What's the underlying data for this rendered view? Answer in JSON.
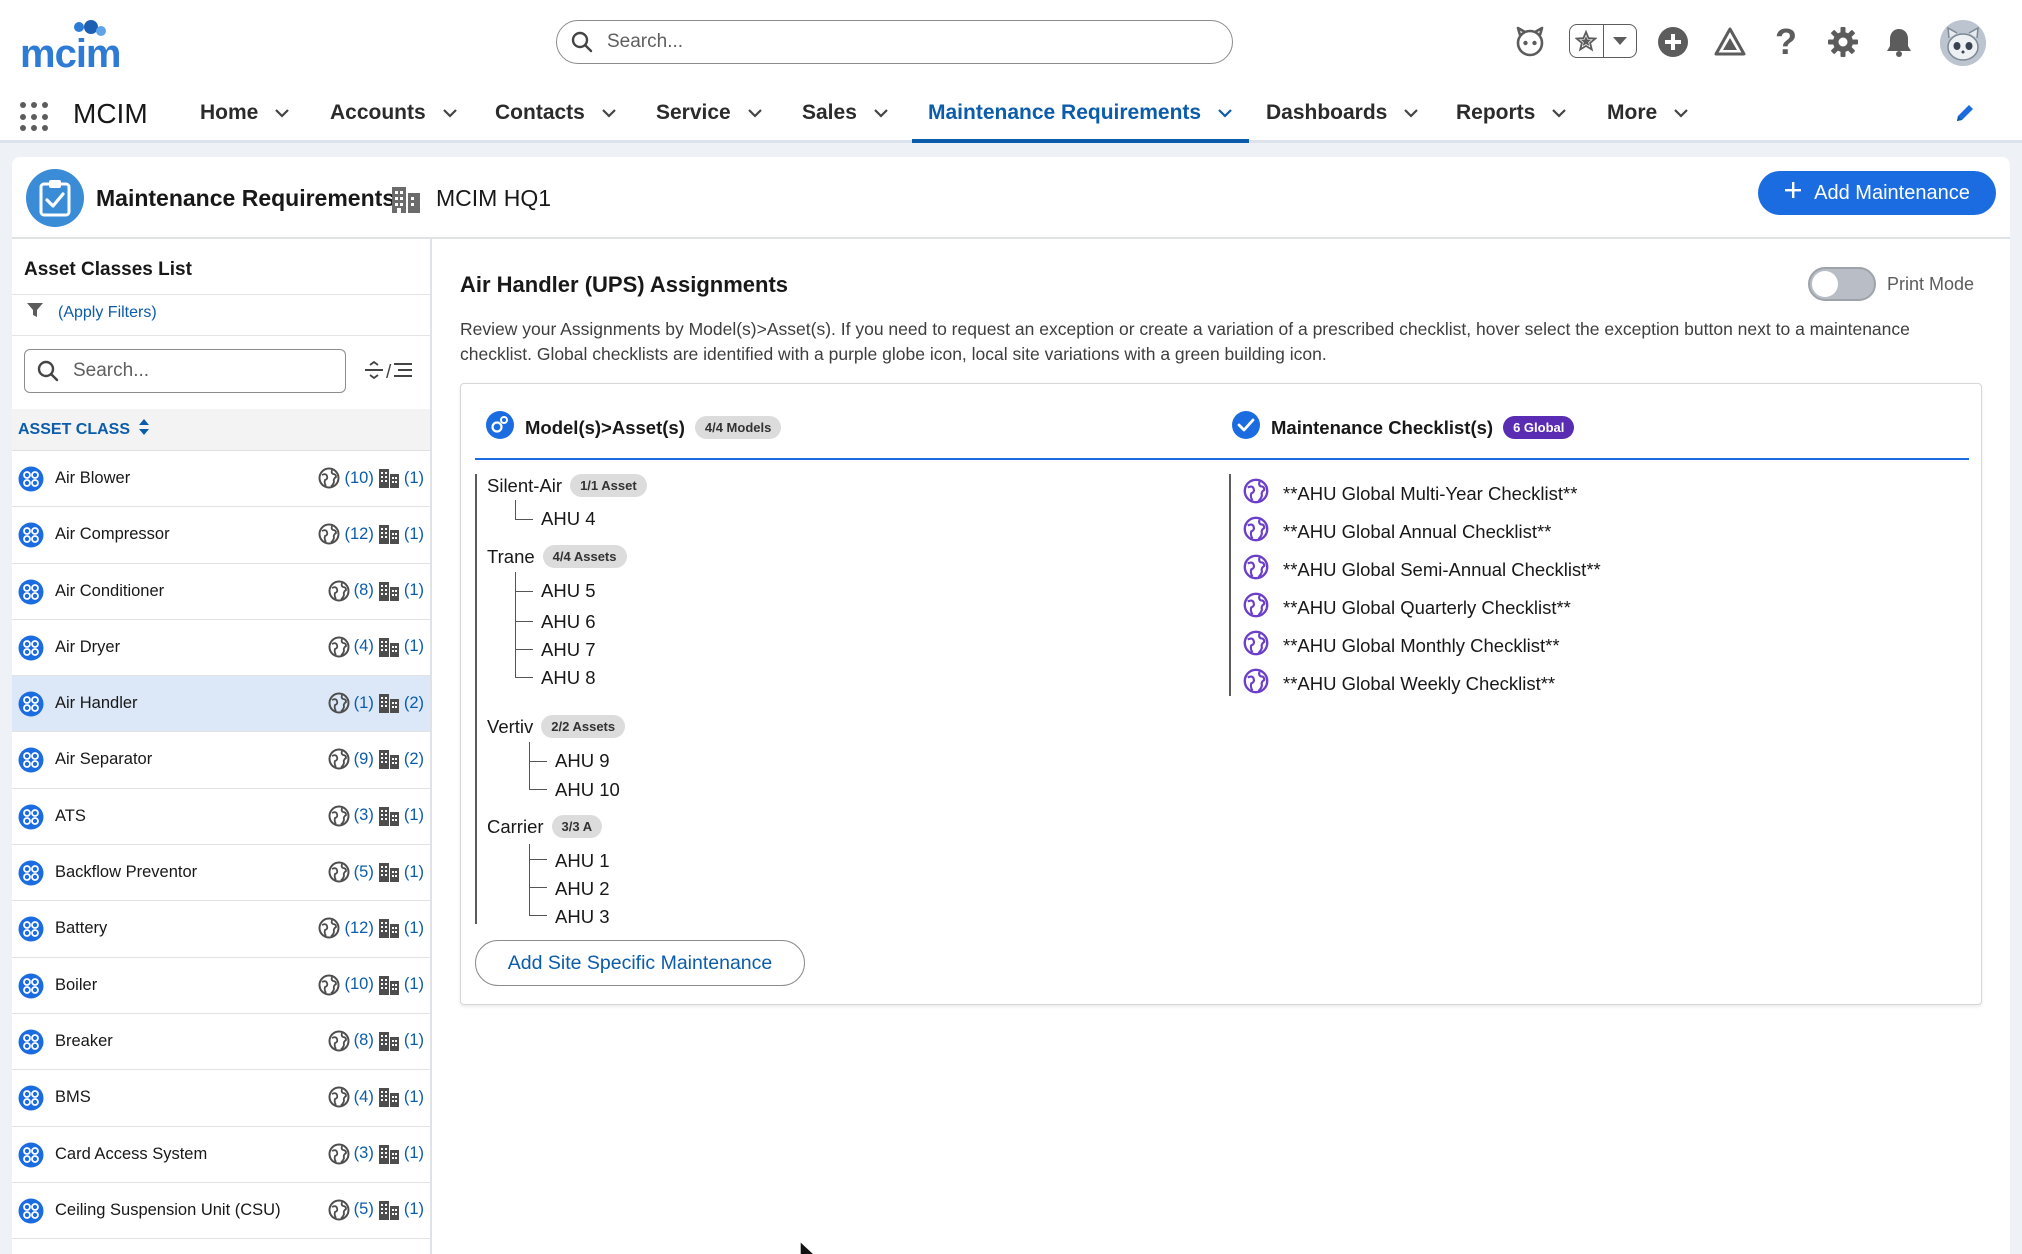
{
  "header": {
    "logo_text": "mcim",
    "search_placeholder": "Search...",
    "icons": [
      "agent-icon",
      "favorites-star-icon",
      "favorites-dropdown-icon",
      "add-icon",
      "setup-assistant-icon",
      "help-icon",
      "settings-icon",
      "notifications-icon",
      "user-avatar"
    ]
  },
  "nav": {
    "app_name": "MCIM",
    "items": [
      {
        "label": "Home"
      },
      {
        "label": "Accounts"
      },
      {
        "label": "Contacts"
      },
      {
        "label": "Service"
      },
      {
        "label": "Sales"
      },
      {
        "label": "Maintenance Requirements",
        "active": true
      },
      {
        "label": "Dashboards"
      },
      {
        "label": "Reports"
      },
      {
        "label": "More"
      }
    ]
  },
  "page": {
    "title": "Maintenance Requirements",
    "site": "MCIM HQ1",
    "add_button": "Add Maintenance"
  },
  "left_panel": {
    "title": "Asset Classes List",
    "filter_label": "(Apply Filters)",
    "search_placeholder": "Search...",
    "tools_sep": "/",
    "column_header": "ASSET CLASS",
    "rows": [
      {
        "name": "Air Blower",
        "global": "(10)",
        "site": "(1)"
      },
      {
        "name": "Air Compressor",
        "global": "(12)",
        "site": "(1)"
      },
      {
        "name": "Air Conditioner",
        "global": "(8)",
        "site": "(1)"
      },
      {
        "name": "Air Dryer",
        "global": "(4)",
        "site": "(1)"
      },
      {
        "name": "Air Handler",
        "global": "(1)",
        "site": "(2)",
        "selected": true
      },
      {
        "name": "Air Separator",
        "global": "(9)",
        "site": "(2)"
      },
      {
        "name": "ATS",
        "global": "(3)",
        "site": "(1)"
      },
      {
        "name": "Backflow Preventor",
        "global": "(5)",
        "site": "(1)"
      },
      {
        "name": "Battery",
        "global": "(12)",
        "site": "(1)"
      },
      {
        "name": "Boiler",
        "global": "(10)",
        "site": "(1)"
      },
      {
        "name": "Breaker",
        "global": "(8)",
        "site": "(1)"
      },
      {
        "name": "BMS",
        "global": "(4)",
        "site": "(1)"
      },
      {
        "name": "Card Access System",
        "global": "(3)",
        "site": "(1)"
      },
      {
        "name": "Ceiling Suspension Unit (CSU)",
        "global": "(5)",
        "site": "(1)"
      }
    ]
  },
  "main": {
    "title": "Air Handler (UPS) Assignments",
    "print_mode_label": "Print Mode",
    "description": "Review your Assignments by Model(s)>Asset(s). If you need to request an exception or create a variation of a prescribed checklist, hover select the exception button next to a maintenance checklist. Global checklists are identified with a purple globe icon, local site variations with a green building icon.",
    "models_header": "Model(s)>Asset(s)",
    "models_badge": "4/4 Models",
    "checklists_header": "Maintenance Checklist(s)",
    "checklists_badge": "6 Global",
    "models": [
      {
        "name": "Silent-Air",
        "badge": "1/1 Asset",
        "assets": [
          "AHU 4"
        ]
      },
      {
        "name": "Trane",
        "badge": "4/4 Assets",
        "assets": [
          "AHU 5",
          "AHU 6",
          "AHU 7",
          "AHU 8"
        ]
      },
      {
        "name": "Vertiv",
        "badge": "2/2 Assets",
        "assets": [
          "AHU 9",
          "AHU 10"
        ]
      },
      {
        "name": "Carrier",
        "badge": "3/3 A",
        "assets": [
          "AHU 1",
          "AHU 2",
          "AHU 3"
        ]
      }
    ],
    "checklists": [
      "**AHU Global Multi-Year Checklist**",
      "**AHU Global Annual Checklist**",
      "**AHU Global Semi-Annual Checklist**",
      "**AHU Global Quarterly Checklist**",
      "**AHU Global Monthly Checklist**",
      "**AHU Global Weekly Checklist**"
    ],
    "site_button": "Add Site Specific Maintenance"
  },
  "colors": {
    "brand_blue": "#1b6ce0",
    "link_blue": "#0b5cab",
    "global_purple": "#5a2bb3",
    "selected_row": "#dce8f8"
  }
}
